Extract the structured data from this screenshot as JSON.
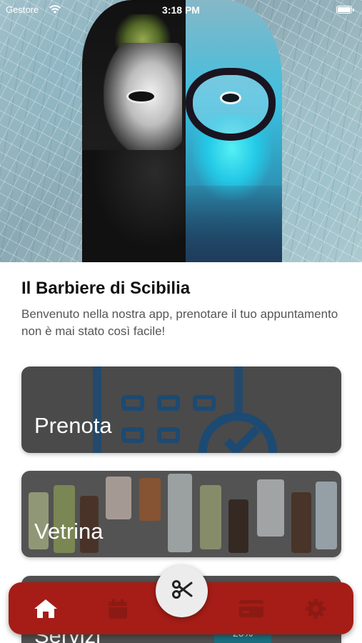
{
  "status_bar": {
    "carrier": "Gestore",
    "time": "3:18 PM"
  },
  "intro": {
    "title": "Il Barbiere di Scibilia",
    "subtitle": "Benvenuto nella nostra app, prenotare il tuo appuntamento non è mai stato così facile!"
  },
  "cards": [
    {
      "label": "Prenota",
      "icon": "calendar-check-icon"
    },
    {
      "label": "Vetrina",
      "icon": "products-photo"
    },
    {
      "label": "Servizi",
      "badge": "20%"
    }
  ],
  "tab_bar": {
    "items": [
      {
        "icon": "home-icon",
        "active": true
      },
      {
        "icon": "calendar-icon",
        "active": false
      },
      {
        "icon": "scissors-icon",
        "active": false
      },
      {
        "icon": "credit-card-icon",
        "active": false
      },
      {
        "icon": "gear-icon",
        "active": false
      }
    ]
  },
  "colors": {
    "tab_bar": "#a51d16",
    "active_icon": "#ffffff",
    "inactive_icon": "#8c1a14",
    "card_text": "#ffffff"
  }
}
